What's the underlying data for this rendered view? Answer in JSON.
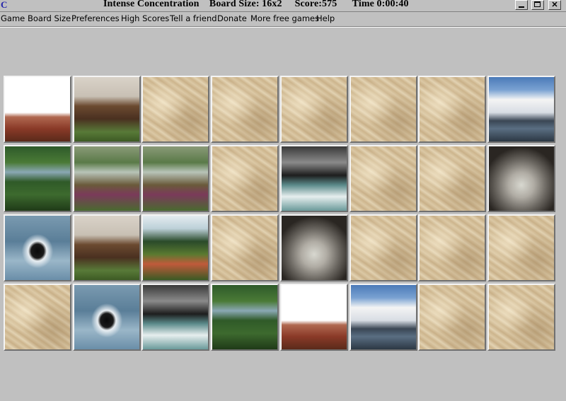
{
  "window": {
    "title": "Intense Concentration    Board Size: 16x2     Score:575      Time 0:00:40"
  },
  "menu": {
    "items": [
      "Game",
      "Board Size",
      "Preferences",
      "High Scores",
      "Tell a friend",
      "Donate",
      "More free games",
      "Help"
    ]
  },
  "board": {
    "rows": 4,
    "cols": 8,
    "cards": [
      "heron",
      "horses",
      "back",
      "back",
      "back",
      "back",
      "back",
      "clouds",
      "forest",
      "woods",
      "woods",
      "back",
      "surf",
      "back",
      "back",
      "rocks",
      "loon",
      "horses",
      "garden",
      "back",
      "rocks",
      "back",
      "back",
      "back",
      "back",
      "loon",
      "surf",
      "forest",
      "heron",
      "clouds",
      "back",
      "back"
    ]
  }
}
